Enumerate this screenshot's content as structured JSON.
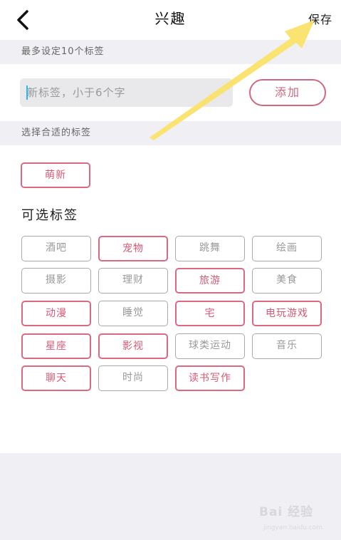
{
  "header": {
    "title": "兴趣",
    "save_label": "保存"
  },
  "sections": {
    "max_hint": "最多设定10个标签",
    "choose_hint": "选择合适的标签"
  },
  "input": {
    "placeholder": "新标签，小于6个字",
    "value": ""
  },
  "add_button_label": "添加",
  "selected_tags": [
    "萌新"
  ],
  "available_title": "可选标签",
  "available_tags": [
    {
      "label": "酒吧",
      "selected": false
    },
    {
      "label": "宠物",
      "selected": true
    },
    {
      "label": "跳舞",
      "selected": false
    },
    {
      "label": "绘画",
      "selected": false
    },
    {
      "label": "摄影",
      "selected": false
    },
    {
      "label": "理财",
      "selected": false
    },
    {
      "label": "旅游",
      "selected": true
    },
    {
      "label": "美食",
      "selected": false
    },
    {
      "label": "动漫",
      "selected": true
    },
    {
      "label": "睡觉",
      "selected": false
    },
    {
      "label": "宅",
      "selected": true
    },
    {
      "label": "电玩游戏",
      "selected": true
    },
    {
      "label": "星座",
      "selected": true
    },
    {
      "label": "影视",
      "selected": true
    },
    {
      "label": "球类运动",
      "selected": false
    },
    {
      "label": "音乐",
      "selected": false
    },
    {
      "label": "聊天",
      "selected": true
    },
    {
      "label": "时尚",
      "selected": false
    },
    {
      "label": "读书写作",
      "selected": true
    }
  ],
  "colors": {
    "accent": "#d96a82",
    "unselected_border": "#a9a9a9",
    "section_bg": "#efeff4",
    "arrow": "#fbe16a"
  },
  "watermark": {
    "brand": "Bai 经验",
    "url": "jingyan.baidu.com"
  }
}
